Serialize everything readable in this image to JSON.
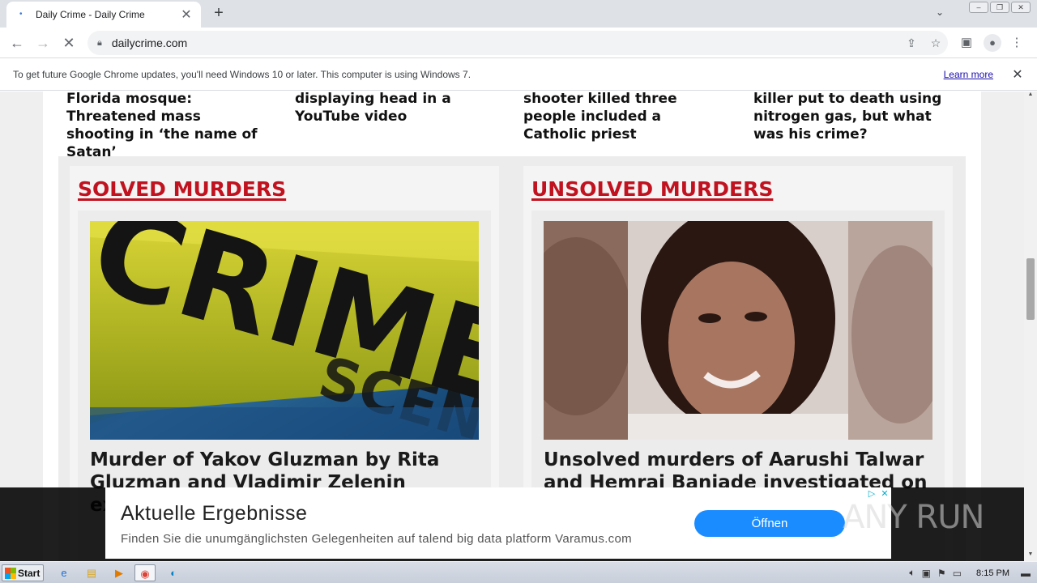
{
  "browser": {
    "tab_title": "Daily Crime - Daily Crime",
    "url": "dailycrime.com",
    "infobar_message": "To get future Google Chrome updates, you'll need Windows 10 or later. This computer is using Windows 7.",
    "infobar_link": "Learn more"
  },
  "page": {
    "headlines": [
      {
        "text": "Florida mosque: Threatened mass shooting in ‘the name of Satan’"
      },
      {
        "text": "displaying head in a YouTube video"
      },
      {
        "text": "shooter killed three people included a Catholic priest"
      },
      {
        "text": "killer put to death using nitrogen gas, but what was his crime?"
      }
    ],
    "solved": {
      "heading": "SOLVED MURDERS",
      "article_title": "Murder of Yakov Gluzman by Rita Gluzman and Vladimir Zelenin examined on",
      "image_text": "CRIME SCENE DO NOT CROSS"
    },
    "unsolved": {
      "heading": "UNSOLVED MURDERS",
      "article_title": "Unsolved murders of Aarushi Talwar and Hemraj Banjade investigated on"
    }
  },
  "ad": {
    "title": "Aktuelle Ergebnisse",
    "description": "Finden Sie die unumgänglichsten Gelegenheiten auf talend big data platform Varamus.com",
    "button": "Öffnen",
    "watermark": "ANY RUN"
  },
  "taskbar": {
    "start_label": "Start",
    "clock": "8:15 PM"
  },
  "colors": {
    "heading_red": "#c1121f",
    "ad_button": "#1a8cff"
  }
}
